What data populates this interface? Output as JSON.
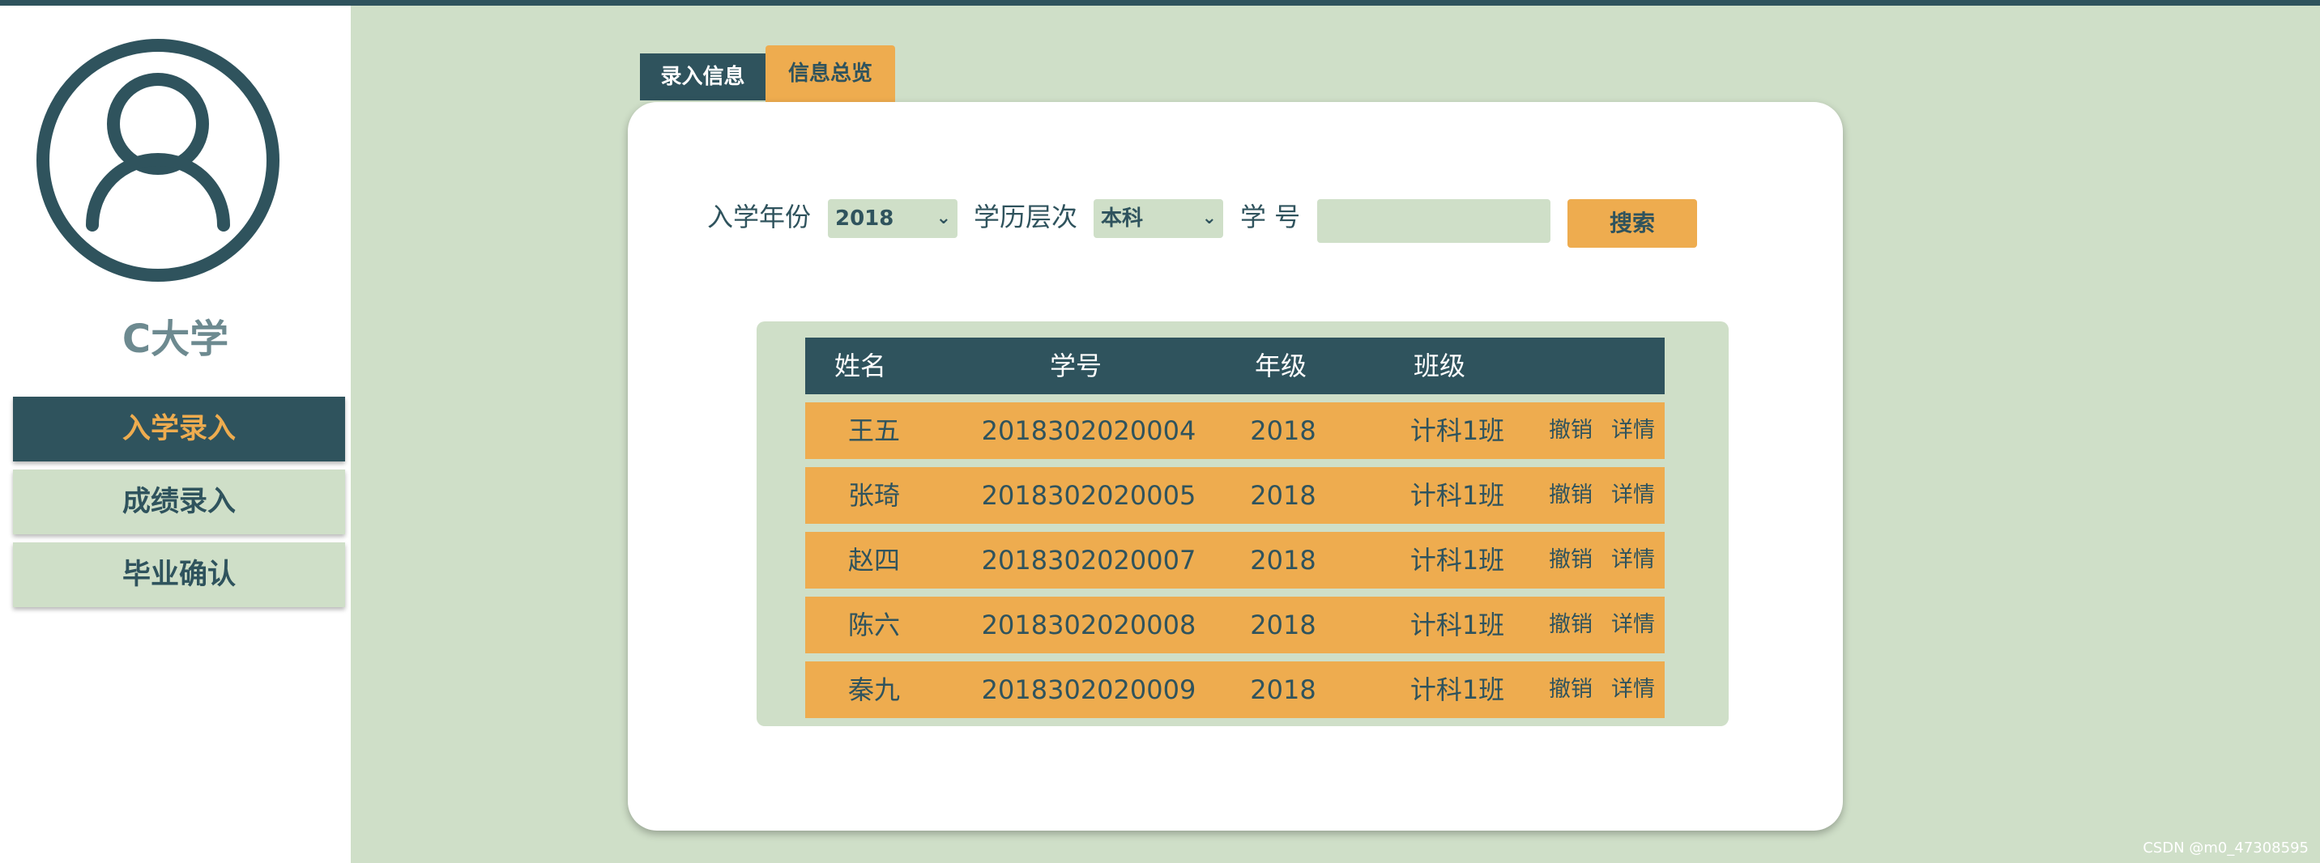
{
  "sidebar": {
    "school_name": "C大学",
    "nav": [
      "入学录入",
      "成绩录入",
      "毕业确认"
    ],
    "active_index": 0
  },
  "tabs": [
    "录入信息",
    "信息总览"
  ],
  "filters": {
    "year_label": "入学年份",
    "year_value": "2018",
    "level_label": "学历层次",
    "level_value": "本科",
    "id_label": "学 号",
    "id_value": "",
    "search_label": "搜索"
  },
  "table": {
    "headers": [
      "姓名",
      "学号",
      "年级",
      "班级"
    ],
    "rows": [
      {
        "name": "王五",
        "id": "2018302020004",
        "grade": "2018",
        "class": "计科1班",
        "cancel": "撤销",
        "detail": "详情"
      },
      {
        "name": "张琦",
        "id": "2018302020005",
        "grade": "2018",
        "class": "计科1班",
        "cancel": "撤销",
        "detail": "详情"
      },
      {
        "name": "赵四",
        "id": "2018302020007",
        "grade": "2018",
        "class": "计科1班",
        "cancel": "撤销",
        "detail": "详情"
      },
      {
        "name": "陈六",
        "id": "2018302020008",
        "grade": "2018",
        "class": "计科1班",
        "cancel": "撤销",
        "detail": "详情"
      },
      {
        "name": "秦九",
        "id": "2018302020009",
        "grade": "2018",
        "class": "计科1班",
        "cancel": "撤销",
        "detail": "详情"
      }
    ]
  },
  "watermark": "CSDN @m0_47308595",
  "colors": {
    "primary": "#2f535d",
    "accent": "#eeac4f",
    "light": "#cfdfc8"
  },
  "icons": {
    "avatar": "user-avatar-icon",
    "select_arrow": "chevron-down-icon"
  }
}
